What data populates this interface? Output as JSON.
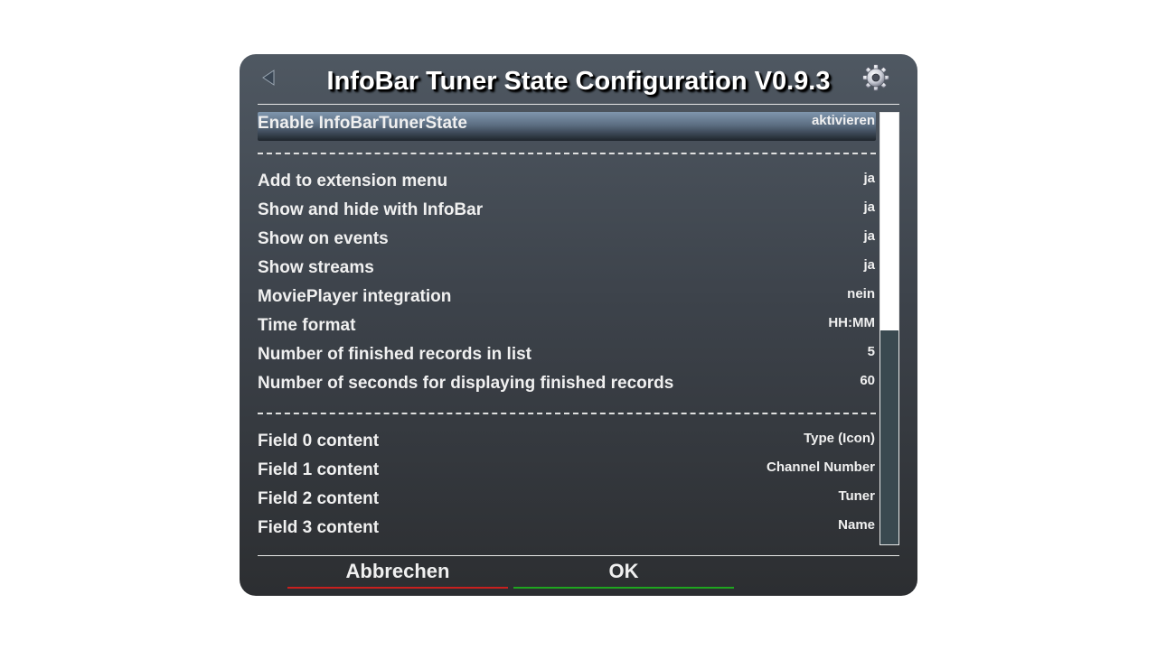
{
  "window": {
    "title": "InfoBar Tuner State Configuration V0.9.3"
  },
  "settings": [
    {
      "label": "Enable InfoBarTunerState",
      "value": "aktivieren",
      "selected": true
    },
    {
      "label": "Add to extension menu",
      "value": "ja"
    },
    {
      "label": "Show and hide with InfoBar",
      "value": "ja"
    },
    {
      "label": "Show on events",
      "value": "ja"
    },
    {
      "label": "Show streams",
      "value": "ja"
    },
    {
      "label": "MoviePlayer integration",
      "value": "nein"
    },
    {
      "label": "Time format",
      "value": "HH:MM"
    },
    {
      "label": "Number of finished records in list",
      "value": "5"
    },
    {
      "label": "Number of seconds for displaying finished records",
      "value": "60"
    },
    {
      "label": "Field 0 content",
      "value": "Type (Icon)"
    },
    {
      "label": "Field 1 content",
      "value": "Channel Number"
    },
    {
      "label": "Field 2 content",
      "value": "Tuner"
    },
    {
      "label": "Field 3 content",
      "value": "Name"
    }
  ],
  "buttons": {
    "red": {
      "label": "Abbrechen",
      "color": "#c8201e"
    },
    "green": {
      "label": "OK",
      "color": "#1fa51f"
    }
  },
  "icons": {
    "back": "back-arrow-icon",
    "settings": "gear-icon"
  }
}
